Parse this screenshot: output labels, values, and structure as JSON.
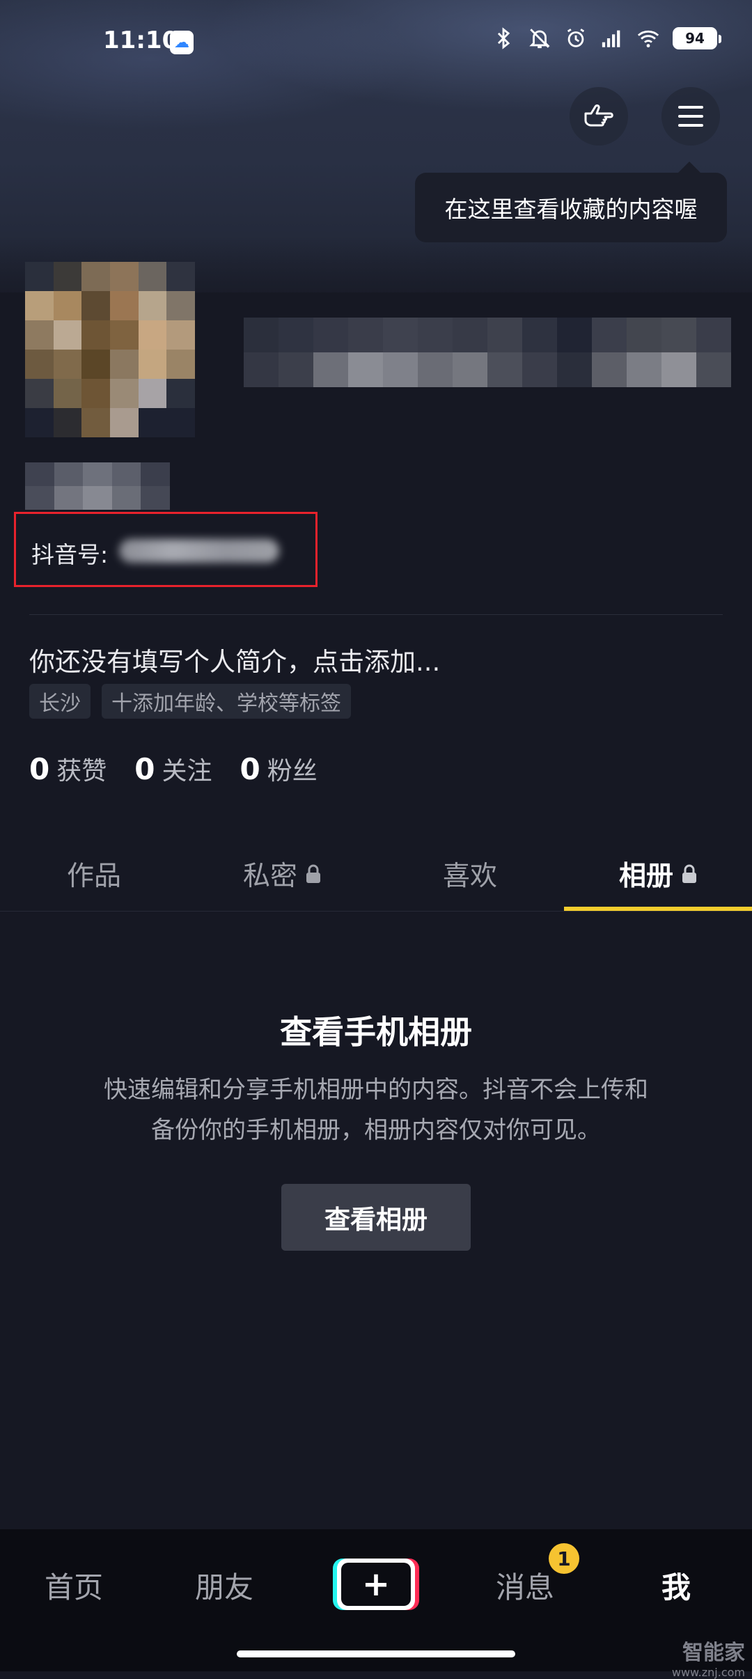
{
  "status_bar": {
    "time": "11:10",
    "battery": "94",
    "icons": [
      "app-cloud-icon",
      "bluetooth-icon",
      "mute-bell-icon",
      "alarm-icon",
      "signal-icon",
      "wifi-icon",
      "battery-icon"
    ]
  },
  "header": {
    "tooltip": "在这里查看收藏的内容喔",
    "icons": [
      "hand-pointer-icon",
      "menu-icon"
    ]
  },
  "profile": {
    "douyin_id_label": "抖音号:",
    "bio": "你还没有填写个人简介，点击添加...",
    "tags": [
      "长沙",
      "十添加年龄、学校等标签"
    ],
    "stats": [
      {
        "num": "0",
        "label": "获赞"
      },
      {
        "num": "0",
        "label": "关注"
      },
      {
        "num": "0",
        "label": "粉丝"
      }
    ]
  },
  "tabs": [
    {
      "label": "作品",
      "locked": false
    },
    {
      "label": "私密",
      "locked": true
    },
    {
      "label": "喜欢",
      "locked": false
    },
    {
      "label": "相册",
      "locked": true
    }
  ],
  "active_tab": "相册",
  "album": {
    "title": "查看手机相册",
    "desc_line1": "快速编辑和分享手机相册中的内容。抖音不会上传和",
    "desc_line2": "备份你的手机相册，相册内容仅对你可见。",
    "button": "查看相册"
  },
  "bottom_nav": {
    "home": "首页",
    "friends": "朋友",
    "create": "+",
    "messages": "消息",
    "messages_badge": "1",
    "me": "我"
  },
  "watermark": {
    "main": "智能家",
    "sub": "www.znj.com"
  },
  "colors": {
    "background": "#161823",
    "accent": "#f4cd2d",
    "badge": "#f6c331",
    "highlight_box": "#e8222c"
  }
}
